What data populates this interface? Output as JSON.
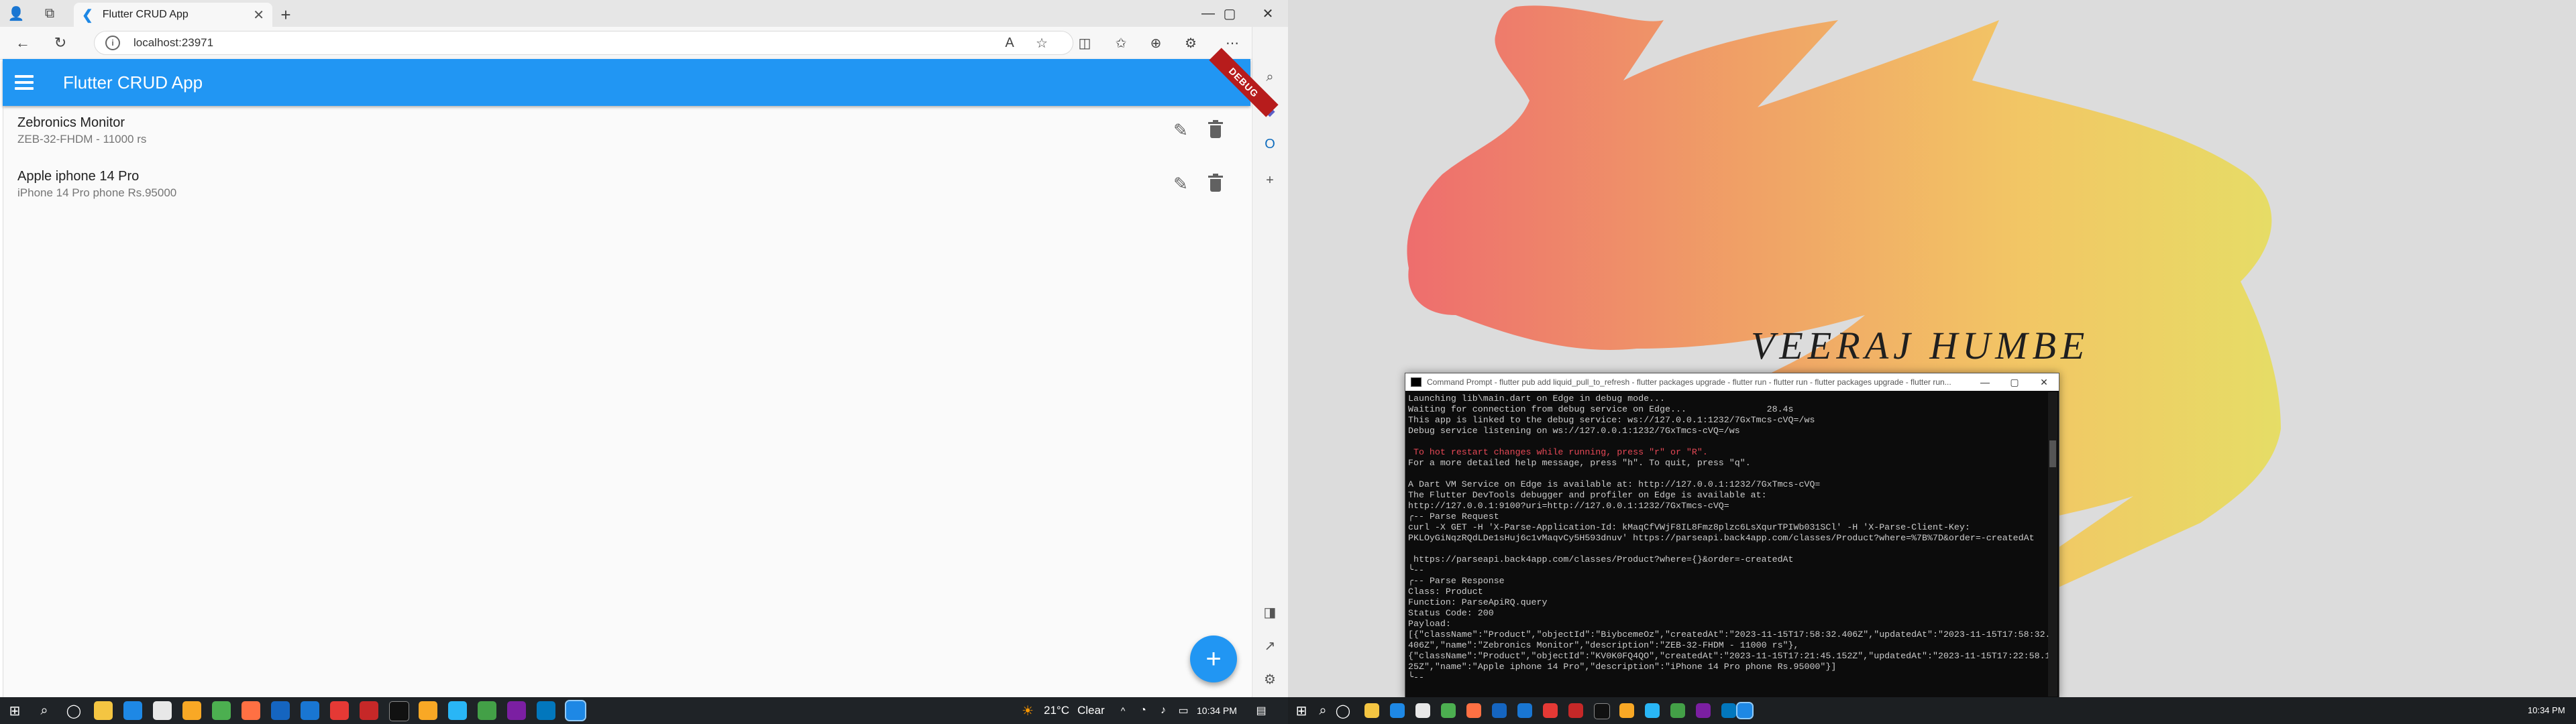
{
  "browser": {
    "tab_title": "Flutter CRUD App",
    "url": "localhost:23971",
    "new_tab_label": "+",
    "minimize": "—",
    "maximize": "▢",
    "close": "✕"
  },
  "app": {
    "title": "Flutter CRUD App",
    "debug_banner": "DEBUG",
    "products": [
      {
        "name": "Zebronics Monitor",
        "description": "ZEB-32-FHDM - 11000 rs"
      },
      {
        "name": "Apple iphone 14 Pro",
        "description": "iPhone 14 Pro phone Rs.95000"
      }
    ],
    "fab_label": "+"
  },
  "taskbar_left": {
    "weather": "21°C",
    "weather_desc": "Clear",
    "time": "10:34 PM"
  },
  "taskbar_right": {
    "time": "10:34 PM"
  },
  "wallpaper": {
    "name": "VEERAJ HUMBE",
    "brush_colors": [
      "#ee6a6a",
      "#f09a63",
      "#f3c561",
      "#e6dd62"
    ]
  },
  "terminal": {
    "title": "Command Prompt - flutter pub add liquid_pull_to_refresh - flutter packages upgrade - flutter run - flutter run - flutter packages upgrade - flutter run...",
    "lines": [
      "Launching lib\\main.dart on Edge in debug mode...",
      "Waiting for connection from debug service on Edge...               28.4s",
      "This app is linked to the debug service: ws://127.0.0.1:1232/7GxTmcs-cVQ=/ws",
      "Debug service listening on ws://127.0.0.1:1232/7GxTmcs-cVQ=/ws",
      "",
      " To hot restart changes while running, press \"r\" or \"R\".",
      "For a more detailed help message, press \"h\". To quit, press \"q\".",
      "",
      "A Dart VM Service on Edge is available at: http://127.0.0.1:1232/7GxTmcs-cVQ=",
      "The Flutter DevTools debugger and profiler on Edge is available at:",
      "http://127.0.0.1:9100?uri=http://127.0.0.1:1232/7GxTmcs-cVQ=",
      "╭-- Parse Request",
      "curl -X GET -H 'X-Parse-Application-Id: kMaqCfVWjF8IL8Fmz8plzc6LsXqurTPIWb031SCl' -H 'X-Parse-Client-Key:",
      "PKLOyGiNqzRQdLDe1sHuj6c1vMaqvCy5H593dnuv' https://parseapi.back4app.com/classes/Product?where=%7B%7D&order=-createdAt",
      "",
      " https://parseapi.back4app.com/classes/Product?where={}&order=-createdAt",
      "╰--",
      "╭-- Parse Response",
      "Class: Product",
      "Function: ParseApiRQ.query",
      "Status Code: 200",
      "Payload:",
      "[{\"className\":\"Product\",\"objectId\":\"BiybcemeOz\",\"createdAt\":\"2023-11-15T17:58:32.406Z\",\"updatedAt\":\"2023-11-15T17:58:32.",
      "406Z\",\"name\":\"Zebronics Monitor\",\"description\":\"ZEB-32-FHDM - 11000 rs\"},",
      "{\"className\":\"Product\",\"objectId\":\"KV0K0FQ4QO\",\"createdAt\":\"2023-11-15T17:21:45.152Z\",\"updatedAt\":\"2023-11-15T17:22:58.1",
      "25Z\",\"name\":\"Apple iphone 14 Pro\",\"description\":\"iPhone 14 Pro phone Rs.95000\"}]",
      "╰--"
    ]
  }
}
